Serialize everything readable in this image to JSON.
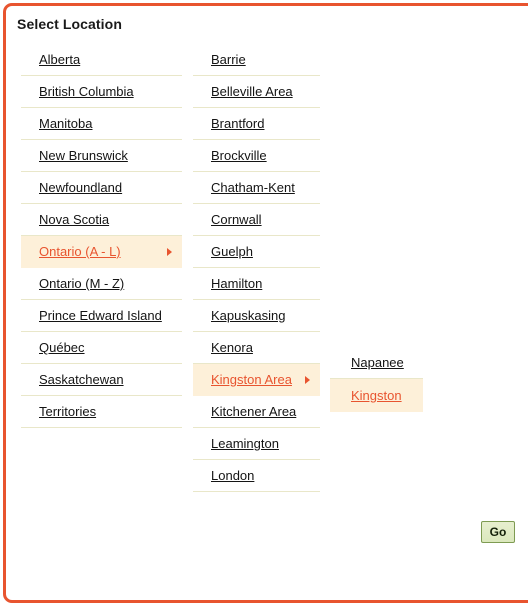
{
  "panel": {
    "title": "Select Location",
    "border_color": "#e8542f",
    "highlight_background": "#fdf0d9",
    "highlight_text_color": "#e8542f",
    "divider_color": "#e9e7c9",
    "link_color": "#141414"
  },
  "columns": {
    "provinces": {
      "name": "provinces-column",
      "items": [
        {
          "label": "Alberta",
          "active": false,
          "has_submenu": false
        },
        {
          "label": "British Columbia",
          "active": false,
          "has_submenu": false
        },
        {
          "label": "Manitoba",
          "active": false,
          "has_submenu": false
        },
        {
          "label": "New Brunswick",
          "active": false,
          "has_submenu": false
        },
        {
          "label": "Newfoundland",
          "active": false,
          "has_submenu": false
        },
        {
          "label": "Nova Scotia",
          "active": false,
          "has_submenu": false
        },
        {
          "label": "Ontario (A - L)",
          "active": true,
          "has_submenu": true
        },
        {
          "label": "Ontario (M - Z)",
          "active": false,
          "has_submenu": false
        },
        {
          "label": "Prince Edward Island",
          "active": false,
          "has_submenu": false
        },
        {
          "label": "Québec",
          "active": false,
          "has_submenu": false
        },
        {
          "label": "Saskatchewan",
          "active": false,
          "has_submenu": false
        },
        {
          "label": "Territories",
          "active": false,
          "has_submenu": false
        }
      ]
    },
    "cities": {
      "name": "cities-column",
      "items": [
        {
          "label": "Barrie",
          "active": false,
          "has_submenu": false
        },
        {
          "label": "Belleville Area",
          "active": false,
          "has_submenu": false
        },
        {
          "label": "Brantford",
          "active": false,
          "has_submenu": false
        },
        {
          "label": "Brockville",
          "active": false,
          "has_submenu": false
        },
        {
          "label": "Chatham-Kent",
          "active": false,
          "has_submenu": false
        },
        {
          "label": "Cornwall",
          "active": false,
          "has_submenu": false
        },
        {
          "label": "Guelph",
          "active": false,
          "has_submenu": false
        },
        {
          "label": "Hamilton",
          "active": false,
          "has_submenu": false
        },
        {
          "label": "Kapuskasing",
          "active": false,
          "has_submenu": false
        },
        {
          "label": "Kenora",
          "active": false,
          "has_submenu": false
        },
        {
          "label": "Kingston Area",
          "active": true,
          "has_submenu": true
        },
        {
          "label": "Kitchener Area",
          "active": false,
          "has_submenu": false
        },
        {
          "label": "Leamington",
          "active": false,
          "has_submenu": false
        },
        {
          "label": "London",
          "active": false,
          "has_submenu": false
        }
      ]
    },
    "areas": {
      "name": "areas-column",
      "items": [
        {
          "label": "Napanee",
          "active": false,
          "has_submenu": false
        },
        {
          "label": "Kingston",
          "active": true,
          "has_submenu": false
        }
      ]
    }
  },
  "go_button": {
    "label": "Go"
  },
  "icons": {
    "submenu_arrow": "caret-right-icon"
  }
}
